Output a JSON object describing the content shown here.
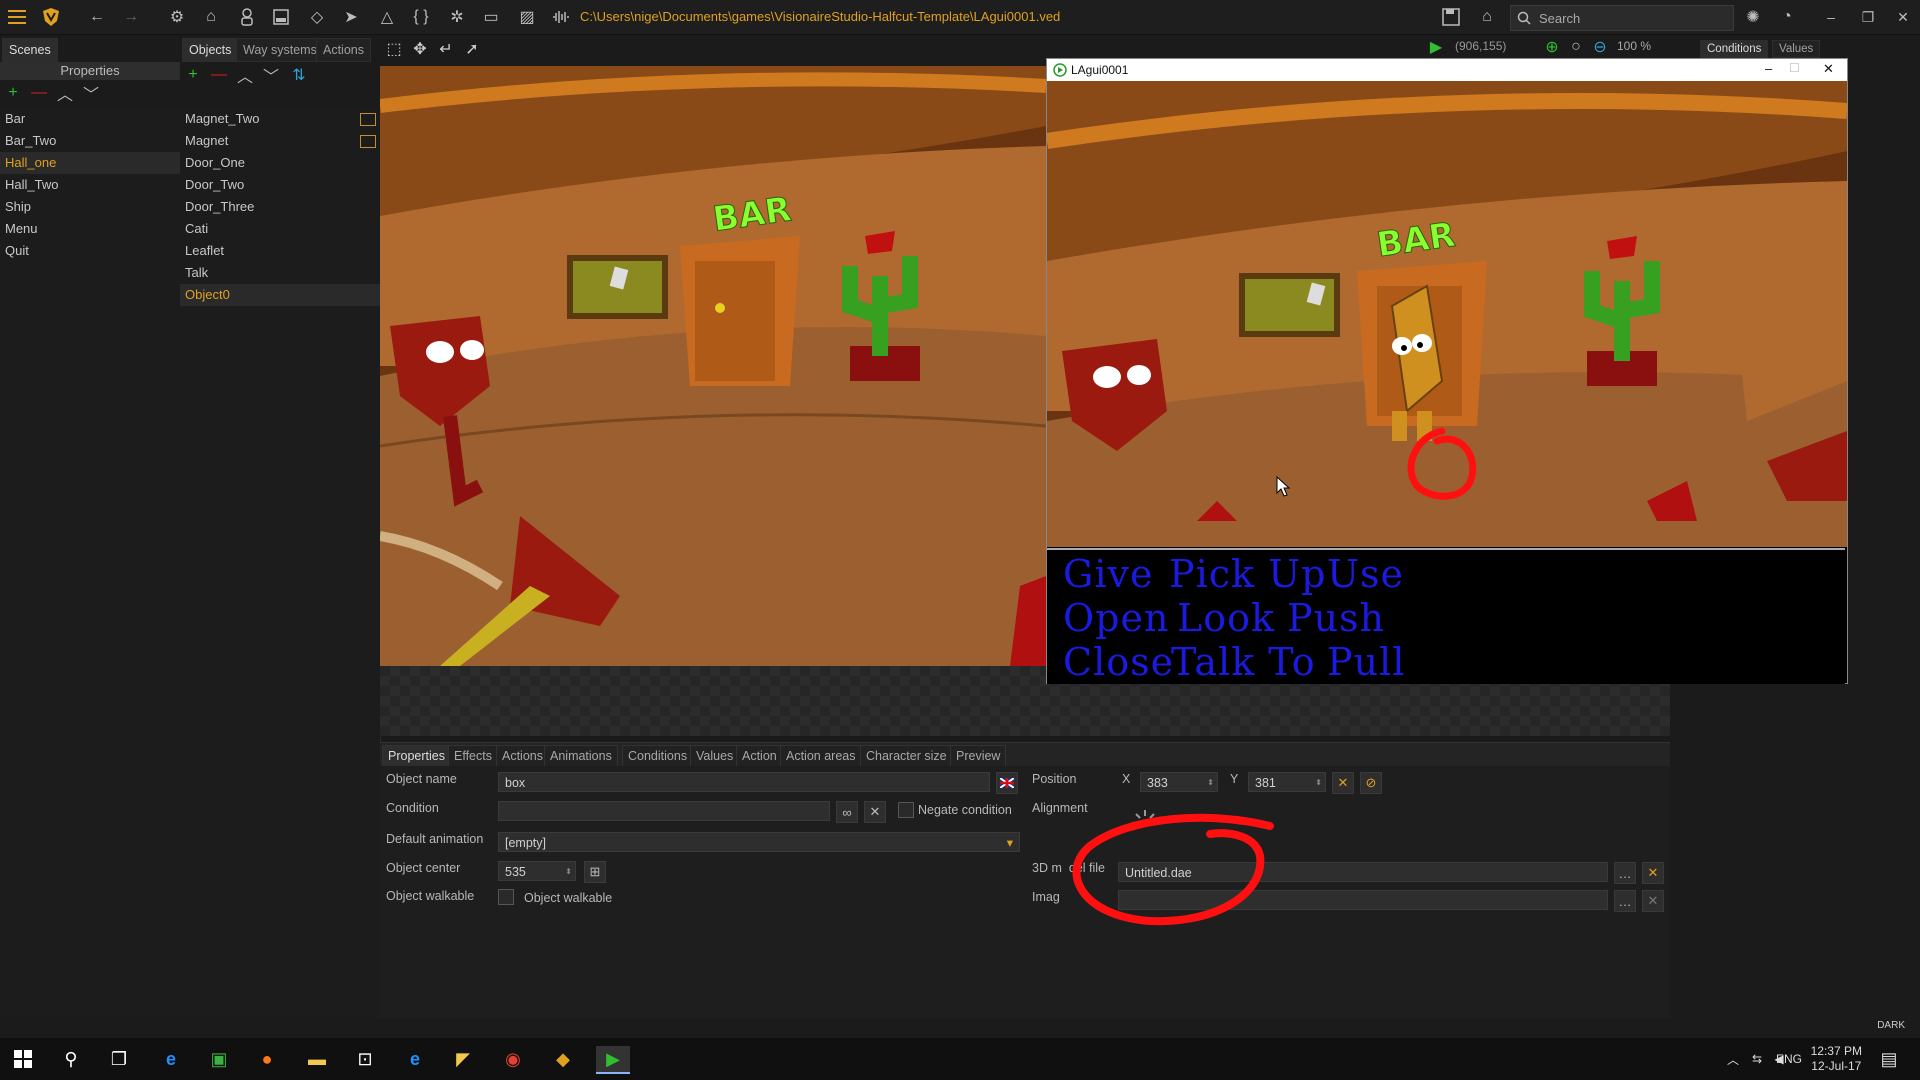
{
  "topbar": {
    "path": "C:\\Users\\nige\\Documents\\games\\VisionaireStudio-Halfcut-Template\\LAgui0001.ved",
    "search_placeholder": "Search"
  },
  "left_tabs": {
    "scenes": "Scenes",
    "properties": "Properties"
  },
  "scenes": [
    "Bar",
    "Bar_Two",
    "Hall_one",
    "Hall_Two",
    "Ship",
    "Menu",
    "Quit"
  ],
  "selected_scene": "Hall_one",
  "object_tabs": [
    "Objects",
    "Way systems",
    "Actions"
  ],
  "objects": [
    "Magnet_Two",
    "Magnet",
    "Door_One",
    "Door_Two",
    "Door_Three",
    "Cati",
    "Leaflet",
    "Talk",
    "Object0"
  ],
  "selected_object": "Object0",
  "viewport_status": {
    "coords": "(906,155)",
    "zoom": "100 %"
  },
  "right_tabs": [
    "Conditions",
    "Values"
  ],
  "viewport_sign": "BAR",
  "game_window": {
    "title": "LAgui0001",
    "sign": "BAR",
    "verbs": [
      [
        "Give",
        "Pick Up",
        "Use"
      ],
      [
        "Open",
        "Look",
        "Push"
      ],
      [
        "Close",
        "Talk To",
        "Pull"
      ]
    ]
  },
  "property_tabs": [
    "Properties",
    "Effects",
    "Actions",
    "Animations",
    "Conditions",
    "Values",
    "Action",
    "Action areas",
    "Character size",
    "Preview"
  ],
  "properties": {
    "object_name_label": "Object name",
    "object_name": "box",
    "condition_label": "Condition",
    "negate_label": "Negate condition",
    "default_animation_label": "Default animation",
    "default_animation": "[empty]",
    "object_center_label": "Object center",
    "object_center": "535",
    "object_walkable_label": "Object walkable",
    "object_walkable_check": "Object walkable",
    "position_label": "Position",
    "x_label": "X",
    "x_value": "383",
    "y_label": "Y",
    "y_value": "381",
    "alignment_label": "Alignment",
    "model_label_a": "3D m",
    "model_label_b": "del file",
    "model_file": "Untitled.dae",
    "image_label": "Imag",
    "image_file": ""
  },
  "status": {
    "theme": "DARK"
  },
  "taskbar": {
    "lang": "ENG",
    "time": "12:37 PM",
    "date": "12-Jul-17"
  },
  "colors": {
    "accent": "#e0a020",
    "verb_blue": "#1a1ae0",
    "annotation_red": "#ff1010"
  }
}
